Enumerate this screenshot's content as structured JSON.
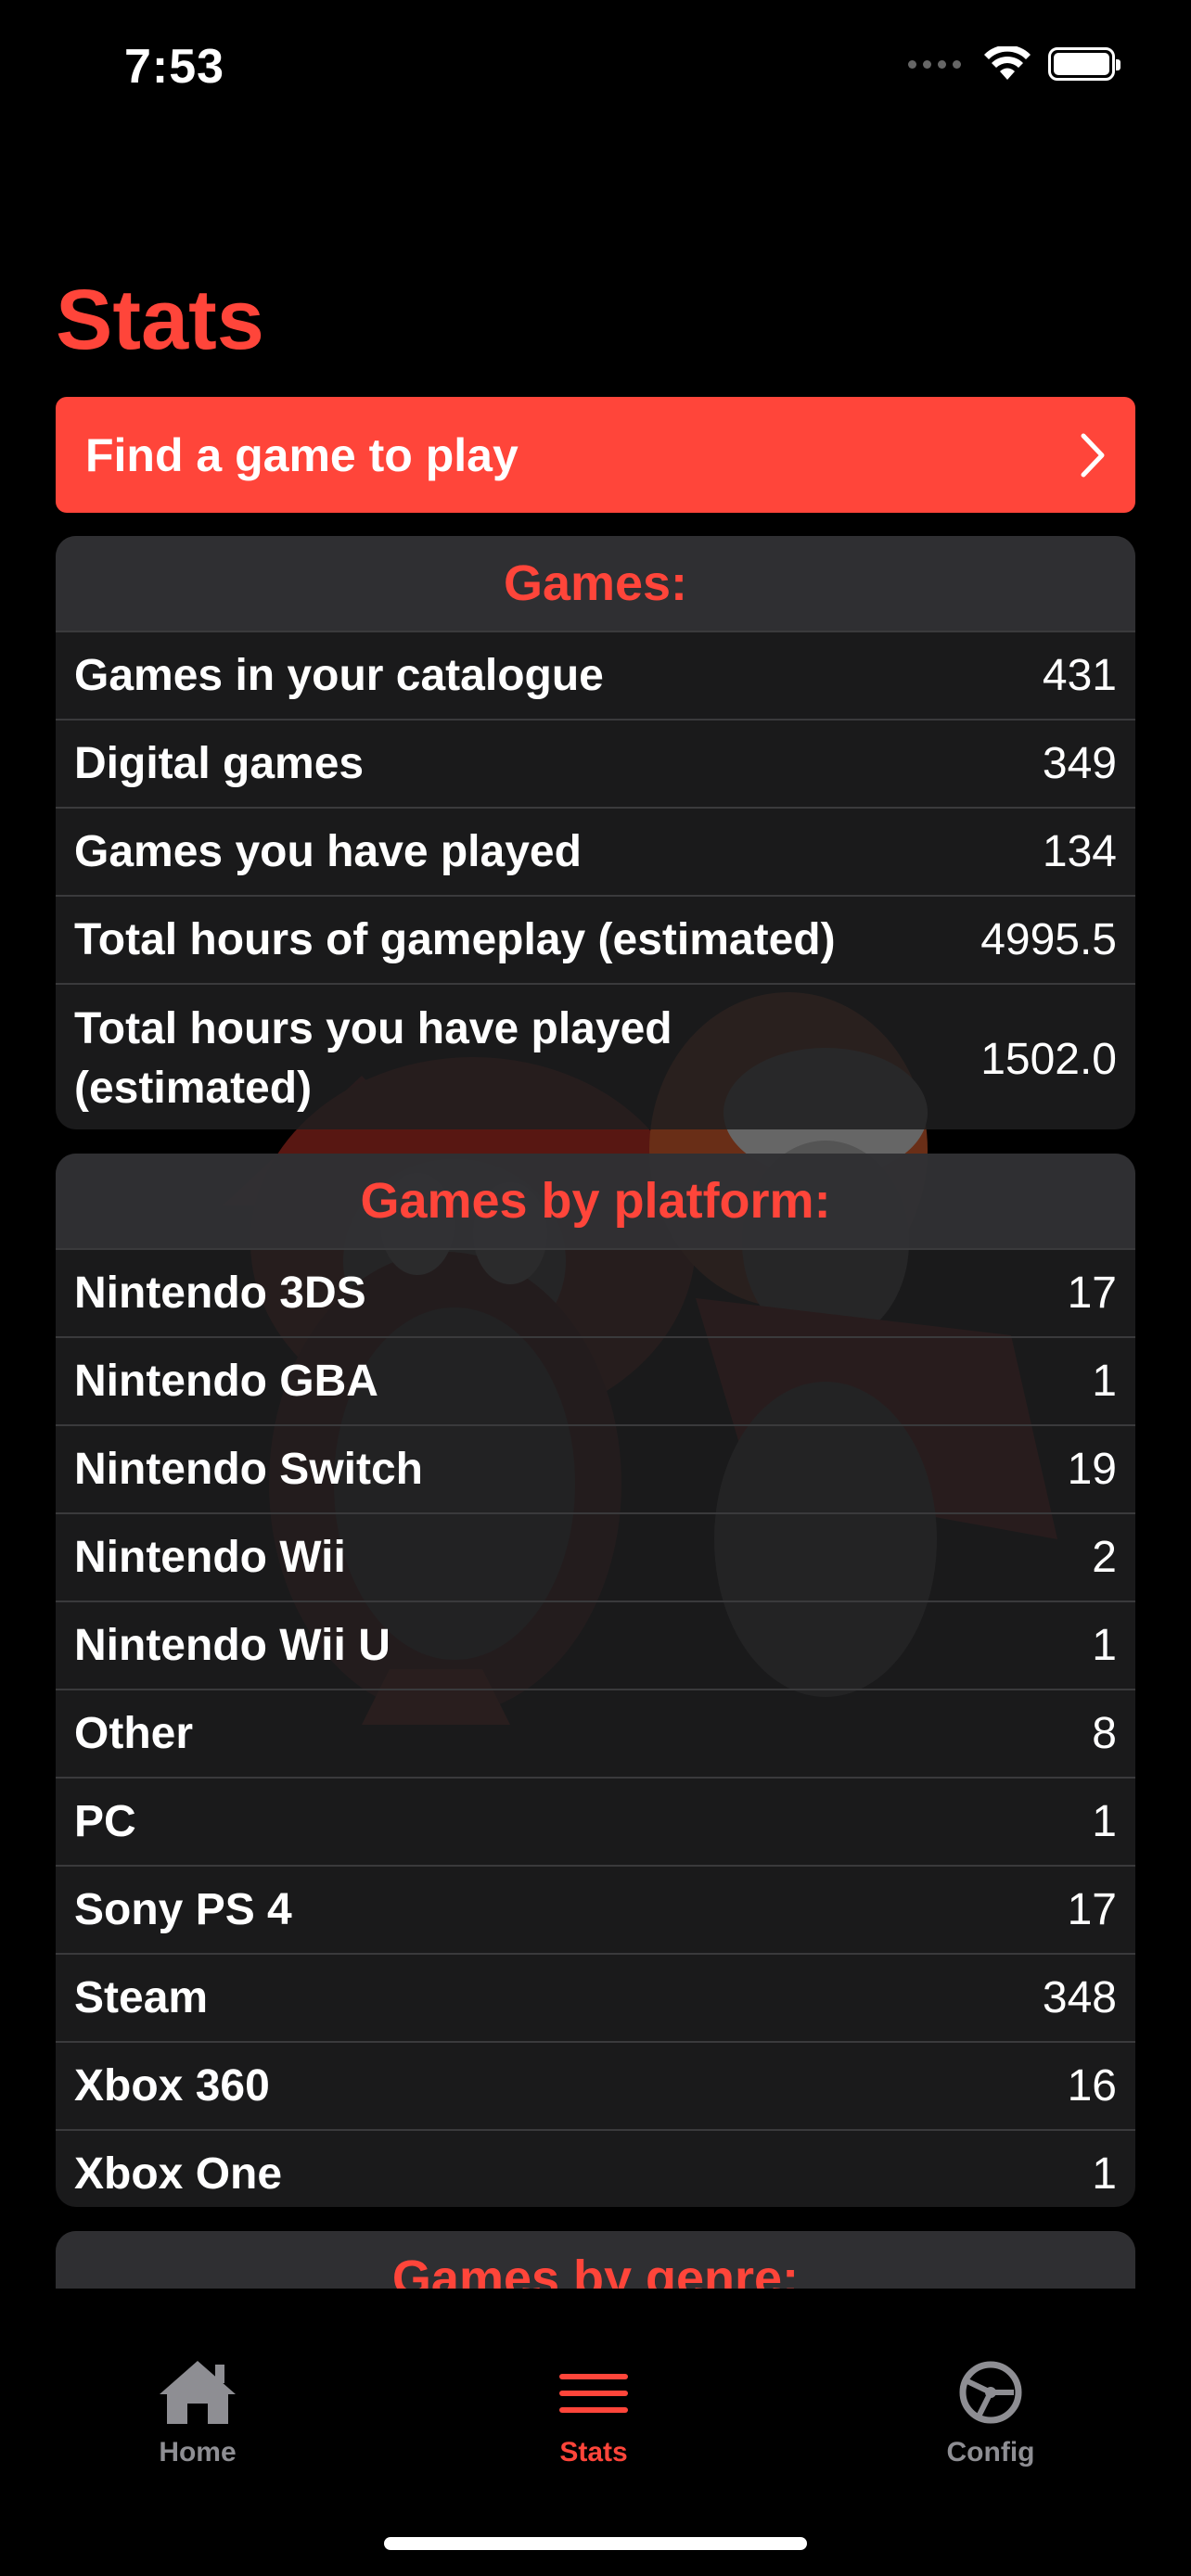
{
  "status_bar": {
    "time": "7:53"
  },
  "page": {
    "title": "Stats"
  },
  "cta": {
    "label": "Find a game to play"
  },
  "games_section": {
    "title": "Games:",
    "rows": [
      {
        "label": "Games in your catalogue",
        "value": "431"
      },
      {
        "label": "Digital games",
        "value": "349"
      },
      {
        "label": "Games you have played",
        "value": "134"
      },
      {
        "label": "Total hours of gameplay (estimated)",
        "value": "4995.5"
      },
      {
        "label": "Total hours you have played (estimated)",
        "value": "1502.0"
      }
    ]
  },
  "platform_section": {
    "title": "Games by platform:",
    "rows": [
      {
        "label": "Nintendo 3DS",
        "value": "17"
      },
      {
        "label": "Nintendo GBA",
        "value": "1"
      },
      {
        "label": "Nintendo Switch",
        "value": "19"
      },
      {
        "label": "Nintendo Wii",
        "value": "2"
      },
      {
        "label": "Nintendo Wii U",
        "value": "1"
      },
      {
        "label": "Other",
        "value": "8"
      },
      {
        "label": "PC",
        "value": "1"
      },
      {
        "label": "Sony PS 4",
        "value": "17"
      },
      {
        "label": "Steam",
        "value": "348"
      },
      {
        "label": "Xbox 360",
        "value": "16"
      },
      {
        "label": "Xbox One",
        "value": "1"
      }
    ]
  },
  "genre_section": {
    "title": "Games by genre:"
  },
  "tab_bar": {
    "tabs": [
      {
        "label": "Home",
        "icon": "house-icon",
        "active": false
      },
      {
        "label": "Stats",
        "icon": "list-icon",
        "active": true
      },
      {
        "label": "Config",
        "icon": "steering-wheel-icon",
        "active": false
      }
    ]
  },
  "colors": {
    "accent": "#ff453a",
    "background": "#000000",
    "card": "#1e1e20",
    "inactive": "#8e8e93"
  }
}
